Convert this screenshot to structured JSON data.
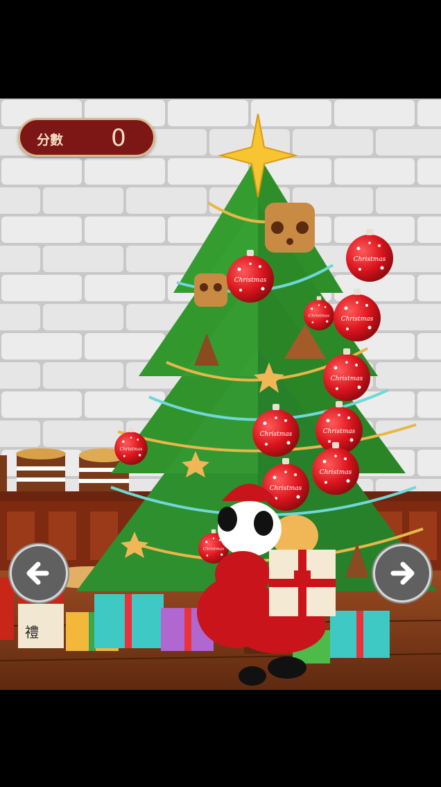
{
  "score": {
    "label": "分數",
    "value": "0"
  },
  "controls": {
    "left": "arrow-left-icon",
    "right": "arrow-right-icon"
  },
  "colors": {
    "wall": "#e3e3e3",
    "mortar": "#c9c9c9",
    "floor": "#7a3a18",
    "tree": "#2e8f2a",
    "ornament": "#d9141c",
    "score_bg": "#7c1716",
    "score_border": "#d9b98d",
    "nav_bg": "#606060"
  }
}
